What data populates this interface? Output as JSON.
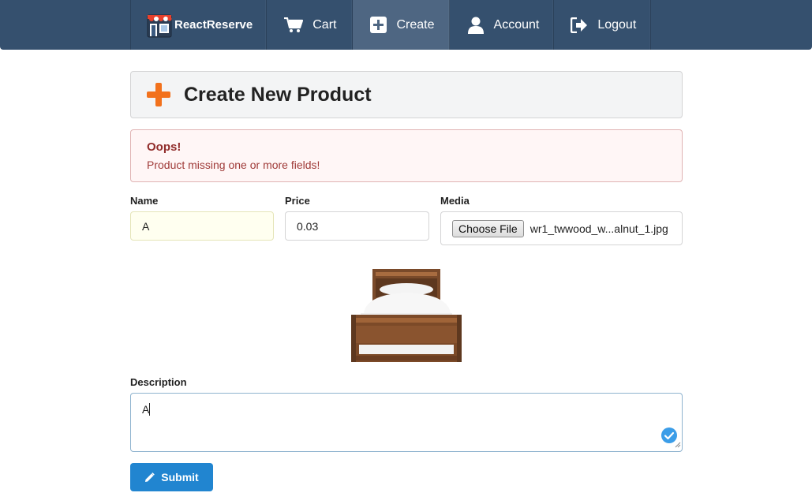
{
  "nav": {
    "brand_label": "ReactReserve",
    "items": [
      {
        "label": "Cart",
        "icon": "cart-icon"
      },
      {
        "label": "Create",
        "icon": "plus-square-icon",
        "active": true
      },
      {
        "label": "Account",
        "icon": "user-icon"
      },
      {
        "label": "Logout",
        "icon": "sign-out-icon"
      }
    ]
  },
  "header": {
    "title": "Create New Product",
    "icon": "plus-icon",
    "icon_color": "#f2711c"
  },
  "error": {
    "title": "Oops!",
    "message": "Product missing one or more fields!"
  },
  "form": {
    "name": {
      "label": "Name",
      "value": "A"
    },
    "price": {
      "label": "Price",
      "value": "0.03"
    },
    "media": {
      "label": "Media",
      "button_label": "Choose File",
      "file_name": "wr1_twwood_w...alnut_1.jpg"
    },
    "description": {
      "label": "Description",
      "value": "A"
    },
    "submit_label": "Submit"
  },
  "colors": {
    "nav_bg": "#35506e",
    "primary": "#2185d0",
    "error_text": "#9f3a38"
  }
}
